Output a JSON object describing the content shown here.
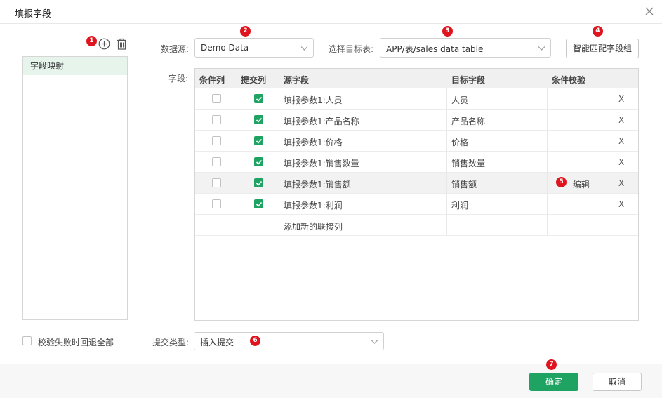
{
  "dialog": {
    "title": "填报字段",
    "close_icon": "close-icon"
  },
  "badges": [
    "1",
    "2",
    "3",
    "4",
    "5",
    "6",
    "7"
  ],
  "left": {
    "add_icon": "plus-circle-icon",
    "delete_icon": "trash-icon",
    "items": [
      {
        "label": "字段映射",
        "selected": true
      }
    ]
  },
  "datasource": {
    "label": "数据源:",
    "value": "Demo Data"
  },
  "target_table": {
    "label": "选择目标表:",
    "value": "APP/表/sales data table"
  },
  "smart_match_button": "智能匹配字段组",
  "fields_label": "字段:",
  "grid": {
    "columns": [
      "条件列",
      "提交列",
      "源字段",
      "目标字段",
      "条件校验"
    ],
    "rows": [
      {
        "condition": false,
        "submit": true,
        "source": "填报参数1:人员",
        "target": "人员",
        "check": "",
        "delete": "X"
      },
      {
        "condition": false,
        "submit": true,
        "source": "填报参数1:产品名称",
        "target": "产品名称",
        "check": "",
        "delete": "X"
      },
      {
        "condition": false,
        "submit": true,
        "source": "填报参数1:价格",
        "target": "价格",
        "check": "",
        "delete": "X"
      },
      {
        "condition": false,
        "submit": true,
        "source": "填报参数1:销售数量",
        "target": "销售数量",
        "check": "",
        "delete": "X"
      },
      {
        "condition": false,
        "submit": true,
        "source": "填报参数1:销售额",
        "target": "销售额",
        "check": "编辑",
        "delete": "X",
        "selected": true
      },
      {
        "condition": false,
        "submit": true,
        "source": "填报参数1:利润",
        "target": "利润",
        "check": "",
        "delete": "X"
      }
    ],
    "add_row_label": "添加新的联接列"
  },
  "rollback_checkbox": {
    "label": "校验失败时回退全部",
    "checked": false
  },
  "submit_type": {
    "label": "提交类型:",
    "value": "插入提交"
  },
  "footer": {
    "ok": "确定",
    "cancel": "取消"
  },
  "colors": {
    "accent": "#1ea362",
    "badge": "#e0141e",
    "selected_item": "#e6f4ec"
  }
}
